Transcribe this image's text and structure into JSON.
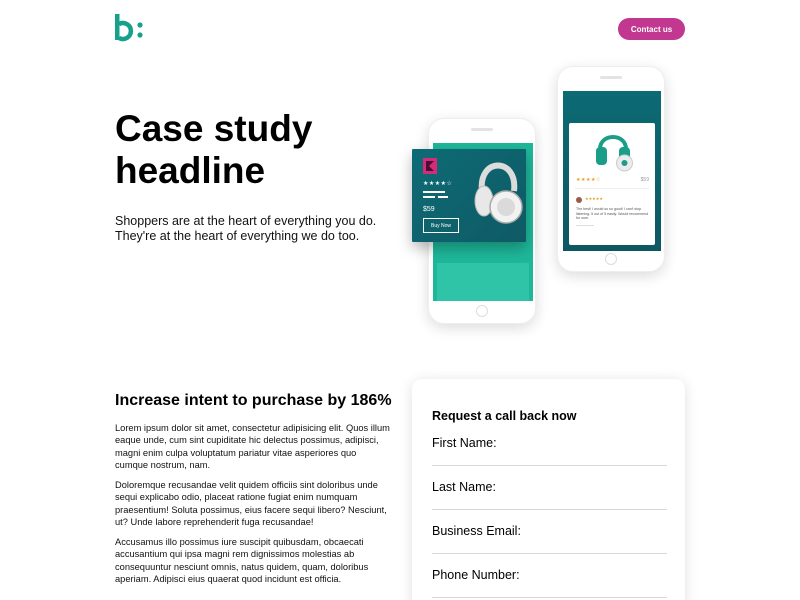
{
  "header": {
    "logo_icon": "b-colon-logo-icon",
    "contact_label": "Contact us",
    "accent_color": "#c2378f",
    "brand_color": "#15a18a"
  },
  "hero": {
    "title": "Case study headline",
    "subtitle": "Shoppers are at the heart of everything you do. They're at the heart of everything we do too."
  },
  "mockup": {
    "back_product": {
      "stars": "★★★★☆",
      "review_stars": "★★★★★",
      "review_text": "The best! I would so so good! I can't stop listening. 5 out of 5 easily. Would recommend for sure."
    },
    "front_card": {
      "stars": "★★★★☆",
      "price": "$59",
      "buy_label": "Buy Now"
    }
  },
  "content": {
    "section_title": "Increase intent to purchase by 186%",
    "paragraphs": [
      "Lorem ipsum dolor sit amet, consectetur adipisicing elit. Quos illum eaque unde, cum sint cupiditate hic delectus possimus, adipisci, magni enim culpa voluptatum pariatur vitae asperiores quo cumque nostrum, nam.",
      "Doloremque recusandae velit quidem officiis sint doloribus unde sequi explicabo odio, placeat ratione fugiat enim numquam praesentium! Soluta possimus, eius facere sequi libero? Nesciunt, ut? Unde labore reprehenderit fuga recusandae!",
      "Accusamus illo possimus iure suscipit quibusdam, obcaecati accusantium qui ipsa magni rem dignissimos molestias ab consequuntur nesciunt omnis, natus quidem, quam, doloribus aperiam. Adipisci eius quaerat quod incidunt est officia."
    ]
  },
  "form": {
    "title": "Request a call back now",
    "fields": [
      {
        "label": "First Name:",
        "value": ""
      },
      {
        "label": "Last Name:",
        "value": ""
      },
      {
        "label": "Business Email:",
        "value": ""
      },
      {
        "label": "Phone Number:",
        "value": ""
      }
    ]
  }
}
